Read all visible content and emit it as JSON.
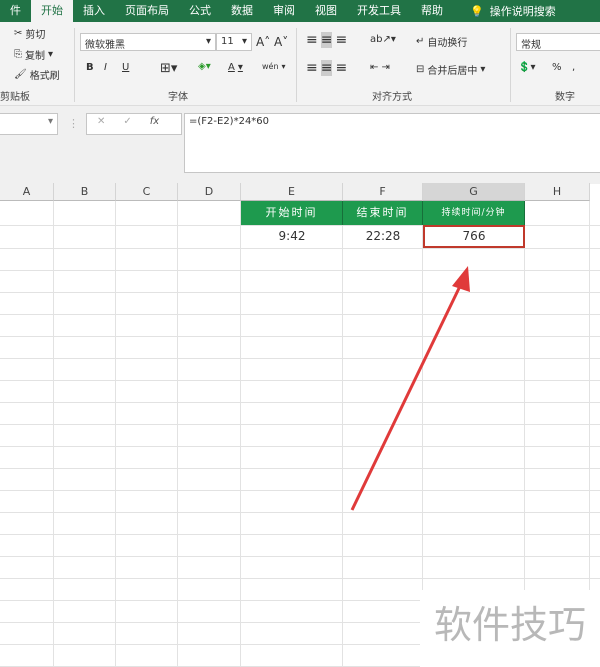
{
  "ribbon_tabs": [
    "件",
    "开始",
    "插入",
    "页面布局",
    "公式",
    "数据",
    "审阅",
    "视图",
    "开发工具",
    "帮助"
  ],
  "search_hint": "操作说明搜索",
  "clipboard": {
    "cut": "剪切",
    "copy": "复制",
    "format_painter": "格式刷",
    "label": "剪贴板"
  },
  "font": {
    "name": "微软雅黑",
    "size": "11",
    "label": "字体",
    "bold": "B",
    "italic": "I",
    "underline": "U",
    "color": "A",
    "phonetic": "wén"
  },
  "alignment": {
    "wrap": "自动换行",
    "merge": "合并后居中",
    "label": "对齐方式"
  },
  "number": {
    "format": "常规",
    "percent": "%",
    "comma": ",",
    "label": "数字"
  },
  "formula_bar": {
    "formula": "=(F2-E2)*24*60",
    "fx": "fx",
    "cancel": "✕",
    "enter": "✓"
  },
  "columns": [
    "A",
    "B",
    "C",
    "D",
    "E",
    "F",
    "G",
    "H"
  ],
  "headers": {
    "E": "开始时间",
    "F": "结束时间",
    "G": "持续时间/分钟"
  },
  "values": {
    "E": "9:42",
    "F": "22:28",
    "G": "766"
  },
  "watermark": "软件技巧",
  "colors": {
    "excel_green": "#217346",
    "header_fill": "#1e9a4e",
    "selection": "#c0392b",
    "arrow": "#e03a3a"
  }
}
